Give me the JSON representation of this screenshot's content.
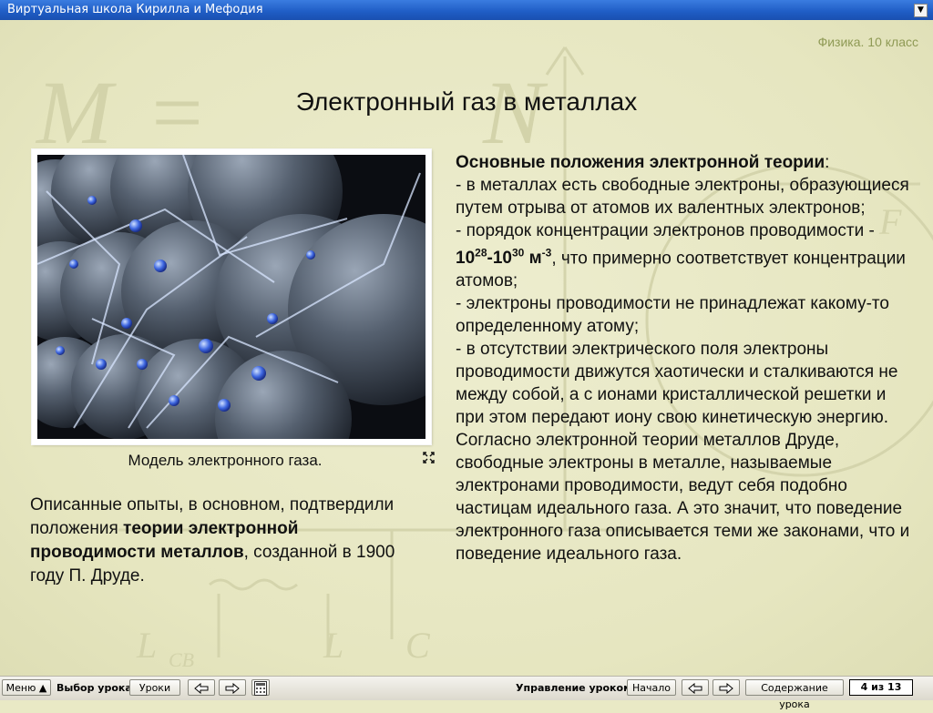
{
  "window": {
    "title": "Виртуальная школа Кирилла и Мефодия"
  },
  "header": {
    "grade": "Физика. 10 класс"
  },
  "lesson": {
    "title": "Электронный газ в металлах",
    "image_caption": "Модель электронного газа.",
    "left_text": {
      "part1": "Описанные опыты, в основном, подтвердили положения ",
      "bold": "теории электронной проводимости металлов",
      "part2": ", созданной в 1900 году П. Друде."
    },
    "right_text": {
      "heading": "Основные положения электронной теории",
      "colon": ":",
      "p1": "- в металлах есть свободные электроны, образующиеся путем отрыва от атомов их валентных электронов;\n- порядок концентрации электронов проводимости - ",
      "exp_base1": "10",
      "exp1": "28",
      "dash": "-",
      "exp_base2": "10",
      "exp2": "30",
      "unit": " м",
      "unit_exp": "-3",
      "p2": ", что примерно соответствует концентрации атомов;\n- электроны проводимости не принадлежат какому-то определенному атому;\n- в отсутствии электрического поля электроны проводимости движутся хаотически и сталкиваются не между собой, а с ионами кристаллической решетки и при этом передают иону свою кинетическую энергию.\nСогласно электронной теории металлов Друде, свободные электроны в металле, называемые электронами проводимости, ведут себя подобно частицам идеального газа.  А это значит, что поведение электронного газа описывается теми же законами, что и поведение идеального газа."
    }
  },
  "toolbar": {
    "menu": "Меню",
    "lesson_select_label": "Выбор урока:",
    "lessons_button": "Уроки",
    "lesson_control_label": "Управление уроком:",
    "start_button": "Начало",
    "contents_button": "Содержание урока",
    "page_counter": "4 из 13"
  }
}
